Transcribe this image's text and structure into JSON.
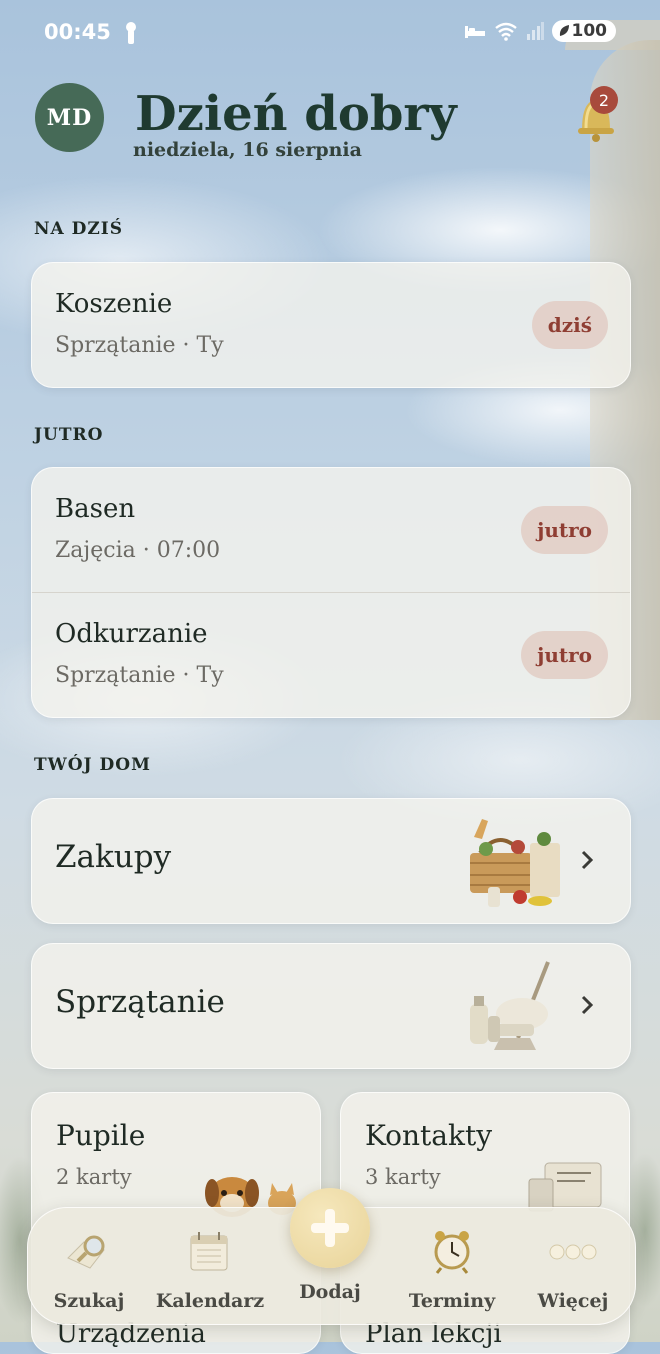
{
  "status_bar": {
    "time": "00:45",
    "battery": "100"
  },
  "header": {
    "avatar_initials": "MD",
    "greeting": "Dzień dobry",
    "date": "niedziela, 16 sierpnia",
    "notification_count": "2"
  },
  "sections": {
    "today": {
      "label": "NA DZIŚ",
      "items": [
        {
          "title": "Koszenie",
          "subtitle": "Sprzątanie · Ty",
          "badge": "dziś"
        }
      ]
    },
    "tomorrow": {
      "label": "JUTRO",
      "items": [
        {
          "title": "Basen",
          "subtitle": "Zajęcia · 07:00",
          "badge": "jutro"
        },
        {
          "title": "Odkurzanie",
          "subtitle": "Sprzątanie · Ty",
          "badge": "jutro"
        }
      ]
    },
    "home": {
      "label": "TWÓJ DOM",
      "cards": [
        {
          "title": "Zakupy",
          "icon": "groceries-basket-icon"
        },
        {
          "title": "Sprzątanie",
          "icon": "cleaning-supplies-icon"
        }
      ],
      "tiles": [
        {
          "title": "Pupile",
          "subtitle": "2 karty",
          "icon": "pets-icon"
        },
        {
          "title": "Kontakty",
          "subtitle": "3 karty",
          "icon": "contacts-card-icon"
        }
      ],
      "tiles_partial": [
        {
          "title": "Urządzenia"
        },
        {
          "title": "Plan lekcji"
        }
      ]
    }
  },
  "tab_bar": {
    "tabs": [
      {
        "label": "Szukaj",
        "icon": "search-icon"
      },
      {
        "label": "Kalendarz",
        "icon": "calendar-icon"
      },
      {
        "label": "Dodaj",
        "icon": "plus-icon"
      },
      {
        "label": "Terminy",
        "icon": "alarm-clock-icon"
      },
      {
        "label": "Więcej",
        "icon": "more-dots-icon"
      }
    ]
  },
  "colors": {
    "accent_green": "#466a57",
    "badge_text": "#8f3e33",
    "badge_bg": "#e2cdc4",
    "notification_badge": "#a84a3c",
    "add_button": "#ecd9a2"
  }
}
